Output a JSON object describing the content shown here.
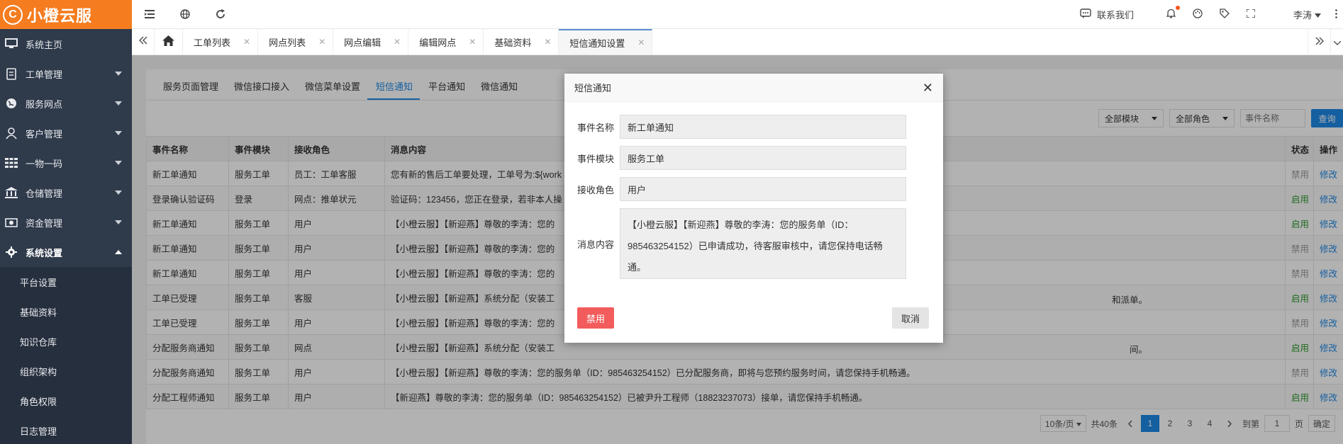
{
  "app": {
    "logo_mark": "C",
    "name": "小橙云服"
  },
  "sidebar": {
    "items": [
      {
        "label": "系统主页",
        "icon": "monitor-icon"
      },
      {
        "label": "工单管理",
        "icon": "document-icon"
      },
      {
        "label": "服务网点",
        "icon": "globe-icon"
      },
      {
        "label": "客户管理",
        "icon": "user-icon"
      },
      {
        "label": "一物一码",
        "icon": "grid-icon"
      },
      {
        "label": "仓储管理",
        "icon": "bank-icon"
      },
      {
        "label": "资金管理",
        "icon": "money-icon"
      },
      {
        "label": "系统设置",
        "icon": "gear-icon"
      }
    ],
    "subitems": [
      {
        "label": "平台设置"
      },
      {
        "label": "基础资料"
      },
      {
        "label": "知识仓库"
      },
      {
        "label": "组织架构"
      },
      {
        "label": "角色权限"
      },
      {
        "label": "日志管理"
      }
    ]
  },
  "topbar": {
    "contact": "联系我们",
    "user": "李涛"
  },
  "tabs": [
    {
      "label": "工单列表"
    },
    {
      "label": "网点列表"
    },
    {
      "label": "网点编辑"
    },
    {
      "label": "编辑网点"
    },
    {
      "label": "基础资料"
    },
    {
      "label": "短信通知设置"
    }
  ],
  "subtabs": [
    {
      "label": "服务页面管理"
    },
    {
      "label": "微信接口接入"
    },
    {
      "label": "微信菜单设置"
    },
    {
      "label": "短信通知"
    },
    {
      "label": "平台通知"
    },
    {
      "label": "微信通知"
    }
  ],
  "filters": {
    "module": "全部模块",
    "role": "全部角色",
    "event_placeholder": "事件名称",
    "query": "查询"
  },
  "table": {
    "headers": [
      "事件名称",
      "事件模块",
      "接收角色",
      "消息内容",
      "状态",
      "操作"
    ],
    "rows": [
      {
        "event": "新工单通知",
        "module": "服务工单",
        "role": "员工：工单客服",
        "content": "您有新的售后工单要处理，工单号为:${work",
        "status": "禁用",
        "status_type": "off",
        "op": "修改"
      },
      {
        "event": "登录确认验证码",
        "module": "登录",
        "role": "网点：推单状元",
        "content": "验证码：123456，您正在登录，若非本人操",
        "status": "启用",
        "status_type": "on",
        "op": "修改"
      },
      {
        "event": "新工单通知",
        "module": "服务工单",
        "role": "用户",
        "content": "【小橙云服】【新迎燕】尊敬的李涛：您的",
        "status": "启用",
        "status_type": "on",
        "op": "修改"
      },
      {
        "event": "新工单通知",
        "module": "服务工单",
        "role": "用户",
        "content": "【小橙云服】【新迎燕】尊敬的李涛：您的",
        "status": "禁用",
        "status_type": "off",
        "op": "修改"
      },
      {
        "event": "新工单通知",
        "module": "服务工单",
        "role": "用户",
        "content": "【小橙云服】【新迎燕】尊敬的李涛：您的",
        "status": "禁用",
        "status_type": "off",
        "op": "修改"
      },
      {
        "event": "工单已受理",
        "module": "服务工单",
        "role": "客服",
        "content": "【小橙云服】【新迎燕】系统分配（安装工",
        "tail": "和派单。",
        "status": "启用",
        "status_type": "on",
        "op": "修改"
      },
      {
        "event": "工单已受理",
        "module": "服务工单",
        "role": "用户",
        "content": "【小橙云服】【新迎燕】尊敬的李涛：您的",
        "status": "禁用",
        "status_type": "off",
        "op": "修改"
      },
      {
        "event": "分配服务商通知",
        "module": "服务工单",
        "role": "网点",
        "content": "【小橙云服】【新迎燕】系统分配（安装工",
        "tail": "间。",
        "status": "启用",
        "status_type": "on",
        "op": "修改"
      },
      {
        "event": "分配服务商通知",
        "module": "服务工单",
        "role": "用户",
        "content": "【小橙云服】【新迎燕】尊敬的李涛：您的服务单（ID：985463254152）已分配服务商，即将与您预约服务时间，请您保持手机畅通。",
        "status": "禁用",
        "status_type": "off",
        "op": "修改"
      },
      {
        "event": "分配工程师通知",
        "module": "服务工单",
        "role": "用户",
        "content": "【新迎燕】尊敬的李涛：您的服务单（ID：985463254152）已被尹升工程师（18823237073）接单，请您保持手机畅通。",
        "status": "启用",
        "status_type": "on",
        "op": "修改"
      }
    ]
  },
  "pager": {
    "page_size": "10条/页",
    "total": "共40条",
    "pages": [
      "1",
      "2",
      "3",
      "4"
    ],
    "current": "1",
    "goto_label": "到第",
    "goto_value": "1",
    "page_unit": "页",
    "confirm": "确定"
  },
  "modal": {
    "title": "短信通知",
    "fields": [
      {
        "label": "事件名称",
        "value": "新工单通知"
      },
      {
        "label": "事件模块",
        "value": "服务工单"
      },
      {
        "label": "接收角色",
        "value": "用户"
      }
    ],
    "content_label": "消息内容",
    "content_value": "【小橙云服】【新迎燕】尊敬的李涛：您的服务单（ID：985463254152）已申请成功，待客服审核中，请您保持电话畅通。",
    "disable_label": "禁用",
    "cancel_label": "取消"
  },
  "colors": {
    "brand": "#f57c1f",
    "sidebar": "#2f3a4b",
    "accent": "#1e88e5",
    "danger": "#f25c5c",
    "enabled": "#2e9a2e"
  }
}
